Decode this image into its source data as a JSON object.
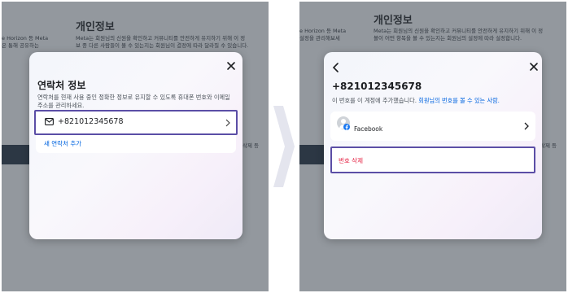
{
  "background": {
    "section_title": "개인정보",
    "left_text_lines": [
      "e Horizon 등 Meta",
      "은 통해 공유하는"
    ],
    "center_text_lines": [
      "Meta는 회원님의 신원을 확인하고 커뮤니티를 안전하게 유지하기 위해 이 정",
      "보 중 다른 사람들이 볼 수 있는지는 회원님이 결정에 따라 달라질 수 있습니다."
    ],
    "band_text": "삭제 등",
    "right_left_text_lines": [
      "e Horizon 등 Meta",
      "설정을 관리해보세"
    ],
    "right_center_text_lines": [
      "Meta는 회원님의 신원을 확인하고 커뮤니티를 안전하게 유지하기 위해 이 정",
      "볼이 어떤 항목을 볼 수 있는지는 회원님의 설정에 따라 설정합니다."
    ]
  },
  "left_modal": {
    "title": "연락처 정보",
    "description": "연락처를 현재 사용 중인 정확한 정보로 유지할 수 있도록 휴대폰 번호와 이메일 주소를 관리하세요.",
    "contact_phone": "+821012345678",
    "add_contact_label": "새 연락처 추가"
  },
  "right_modal": {
    "phone": "+821012345678",
    "added_text": "이 번호를 이 계정에 추가했습니다.",
    "visibility_link": "회원님의 번호를 볼 수 있는 사람.",
    "account_label": "Facebook",
    "delete_label": "번호 삭제"
  },
  "colors": {
    "highlight": "#5b4ea6",
    "link": "#0064e0",
    "danger": "#e41e3f"
  }
}
